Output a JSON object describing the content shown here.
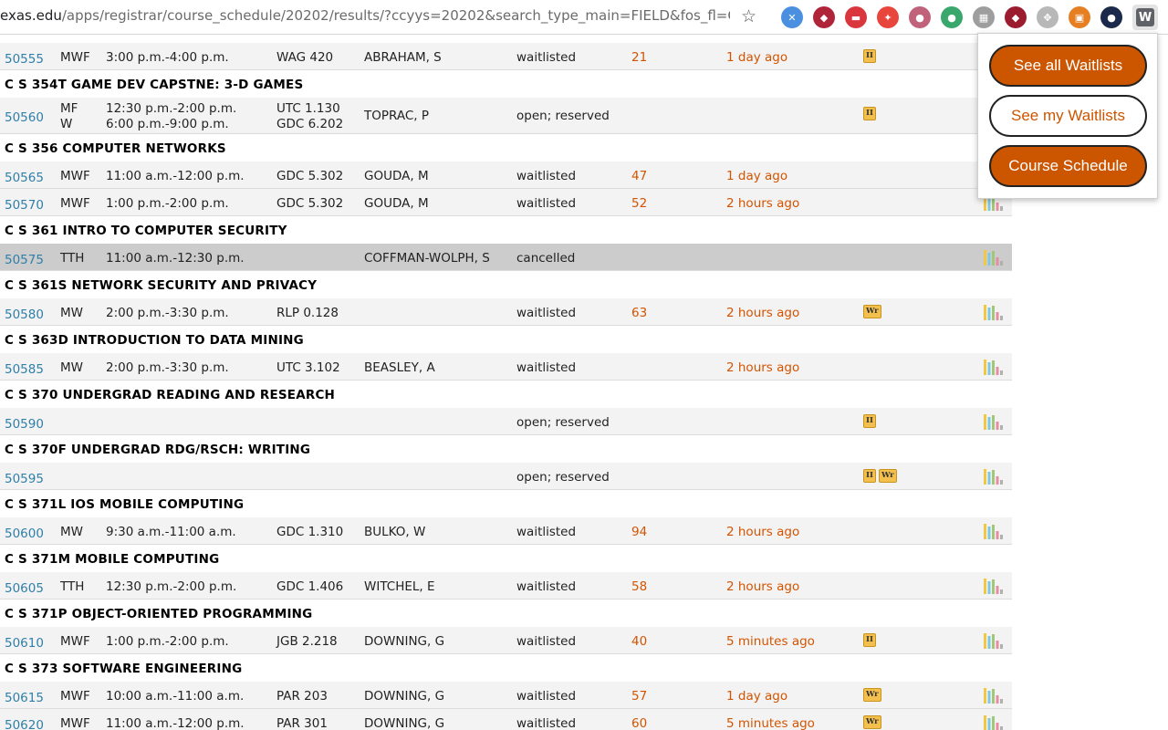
{
  "browser": {
    "url_host": "exas.edu",
    "url_path": "/apps/registrar/course_schedule/20202/results/?ccyys=20202&search_type_main=FIELD&fos_fl=C...",
    "extensions": [
      {
        "name": "ext-blue",
        "color": "#4a8fe0",
        "glyph": "✕"
      },
      {
        "name": "ext-shield",
        "color": "#b0243a",
        "glyph": "◆"
      },
      {
        "name": "ext-red",
        "color": "#d9363e",
        "glyph": "▬"
      },
      {
        "name": "ext-pinwheel",
        "color": "#e8453c",
        "glyph": "✦"
      },
      {
        "name": "ext-purple",
        "color": "#c0627a",
        "glyph": "●"
      },
      {
        "name": "ext-green",
        "color": "#3aa76d",
        "glyph": "●"
      },
      {
        "name": "ext-gray",
        "color": "#9e9e9e",
        "glyph": "▦"
      },
      {
        "name": "ext-shield2",
        "color": "#9b1c2e",
        "glyph": "◆"
      },
      {
        "name": "ext-move",
        "color": "#b8b8b8",
        "glyph": "✥"
      },
      {
        "name": "ext-orange",
        "color": "#e67e22",
        "glyph": "▣"
      },
      {
        "name": "ext-dark",
        "color": "#1b2a4a",
        "glyph": "●"
      }
    ],
    "active_ext_label": "W"
  },
  "popup": {
    "see_all": "See all Waitlists",
    "see_my": "See my Waitlists",
    "course_schedule": "Course Schedule"
  },
  "rows": [
    {
      "type": "section",
      "uid": "50555",
      "days": "MWF",
      "time": "3:00 p.m.-4:00 p.m.",
      "room": "WAG 420",
      "instructor": "ABRAHAM, S",
      "status": "waitlisted",
      "position": "21",
      "updated": "1 day ago",
      "flags": [
        "II"
      ],
      "chart": false
    },
    {
      "type": "header",
      "title": "C S 354T GAME DEV CAPSTNE: 3-D GAMES"
    },
    {
      "type": "section2",
      "uid": "50560",
      "days": "MF",
      "days2": "W",
      "time": "12:30 p.m.-2:00 p.m.",
      "time2": "6:00 p.m.-9:00 p.m.",
      "room": "UTC 1.130",
      "room2": "GDC 6.202",
      "instructor": "TOPRAC, P",
      "status": "open; reserved",
      "position": "",
      "updated": "",
      "flags": [
        "II"
      ],
      "chart": false
    },
    {
      "type": "header",
      "title": "C S 356 COMPUTER NETWORKS"
    },
    {
      "type": "section",
      "uid": "50565",
      "days": "MWF",
      "time": "11:00 a.m.-12:00 p.m.",
      "room": "GDC 5.302",
      "instructor": "GOUDA, M",
      "status": "waitlisted",
      "position": "47",
      "updated": "1 day ago",
      "flags": [],
      "chart": false
    },
    {
      "type": "section",
      "uid": "50570",
      "days": "MWF",
      "time": "1:00 p.m.-2:00 p.m.",
      "room": "GDC 5.302",
      "instructor": "GOUDA, M",
      "status": "waitlisted",
      "position": "52",
      "updated": "2 hours ago",
      "flags": [],
      "chart": true
    },
    {
      "type": "header",
      "title": "C S 361 INTRO TO COMPUTER SECURITY"
    },
    {
      "type": "section",
      "uid": "50575",
      "days": "TTH",
      "time": "11:00 a.m.-12:30 p.m.",
      "room": "",
      "instructor": "COFFMAN-WOLPH, S",
      "status": "cancelled",
      "position": "",
      "updated": "",
      "flags": [],
      "chart": true,
      "cancelled": true
    },
    {
      "type": "header",
      "title": "C S 361S NETWORK SECURITY AND PRIVACY"
    },
    {
      "type": "section",
      "uid": "50580",
      "days": "MW",
      "time": "2:00 p.m.-3:30 p.m.",
      "room": "RLP 0.128",
      "instructor": "",
      "status": "waitlisted",
      "position": "63",
      "updated": "2 hours ago",
      "flags": [
        "Wr"
      ],
      "chart": true
    },
    {
      "type": "header",
      "title": "C S 363D INTRODUCTION TO DATA MINING"
    },
    {
      "type": "section",
      "uid": "50585",
      "days": "MW",
      "time": "2:00 p.m.-3:30 p.m.",
      "room": "UTC 3.102",
      "instructor": "BEASLEY, A",
      "status": "waitlisted",
      "position": "",
      "updated": "2 hours ago",
      "flags": [],
      "chart": true
    },
    {
      "type": "header",
      "title": "C S 370 UNDERGRAD READING AND RESEARCH"
    },
    {
      "type": "section",
      "uid": "50590",
      "days": "",
      "time": "",
      "room": "",
      "instructor": "",
      "status": "open; reserved",
      "position": "",
      "updated": "",
      "flags": [
        "II"
      ],
      "chart": true
    },
    {
      "type": "header",
      "title": "C S 370F UNDERGRAD RDG/RSCH: WRITING"
    },
    {
      "type": "section",
      "uid": "50595",
      "days": "",
      "time": "",
      "room": "",
      "instructor": "",
      "status": "open; reserved",
      "position": "",
      "updated": "",
      "flags": [
        "II",
        "Wr"
      ],
      "chart": true
    },
    {
      "type": "header",
      "title": "C S 371L IOS MOBILE COMPUTING"
    },
    {
      "type": "section",
      "uid": "50600",
      "days": "MW",
      "time": "9:30 a.m.-11:00 a.m.",
      "room": "GDC 1.310",
      "instructor": "BULKO, W",
      "status": "waitlisted",
      "position": "94",
      "updated": "2 hours ago",
      "flags": [],
      "chart": true
    },
    {
      "type": "header",
      "title": "C S 371M MOBILE COMPUTING"
    },
    {
      "type": "section",
      "uid": "50605",
      "days": "TTH",
      "time": "12:30 p.m.-2:00 p.m.",
      "room": "GDC 1.406",
      "instructor": "WITCHEL, E",
      "status": "waitlisted",
      "position": "58",
      "updated": "2 hours ago",
      "flags": [],
      "chart": true
    },
    {
      "type": "header",
      "title": "C S 371P OBJECT-ORIENTED PROGRAMMING"
    },
    {
      "type": "section",
      "uid": "50610",
      "days": "MWF",
      "time": "1:00 p.m.-2:00 p.m.",
      "room": "JGB 2.218",
      "instructor": "DOWNING, G",
      "status": "waitlisted",
      "position": "40",
      "updated": "5 minutes ago",
      "flags": [
        "II"
      ],
      "chart": true
    },
    {
      "type": "header",
      "title": "C S 373 SOFTWARE ENGINEERING"
    },
    {
      "type": "section",
      "uid": "50615",
      "days": "MWF",
      "time": "10:00 a.m.-11:00 a.m.",
      "room": "PAR 203",
      "instructor": "DOWNING, G",
      "status": "waitlisted",
      "position": "57",
      "updated": "1 day ago",
      "flags": [
        "Wr"
      ],
      "chart": true
    },
    {
      "type": "section",
      "uid": "50620",
      "days": "MWF",
      "time": "11:00 a.m.-12:00 p.m.",
      "room": "PAR 301",
      "instructor": "DOWNING, G",
      "status": "waitlisted",
      "position": "60",
      "updated": "5 minutes ago",
      "flags": [
        "Wr"
      ],
      "chart": true
    }
  ],
  "colors": {
    "uid_link": "#2f7fa8",
    "accent_orange": "#cc5500",
    "flag_yellow": "#f4c04d",
    "chart_bars": [
      "#f2c744",
      "#7ec8e3",
      "#a0c878",
      "#e88ca0",
      "#b0b0b0"
    ]
  },
  "icons": {
    "bookmark": "star-icon",
    "distribution": "bar-chart-icon"
  }
}
